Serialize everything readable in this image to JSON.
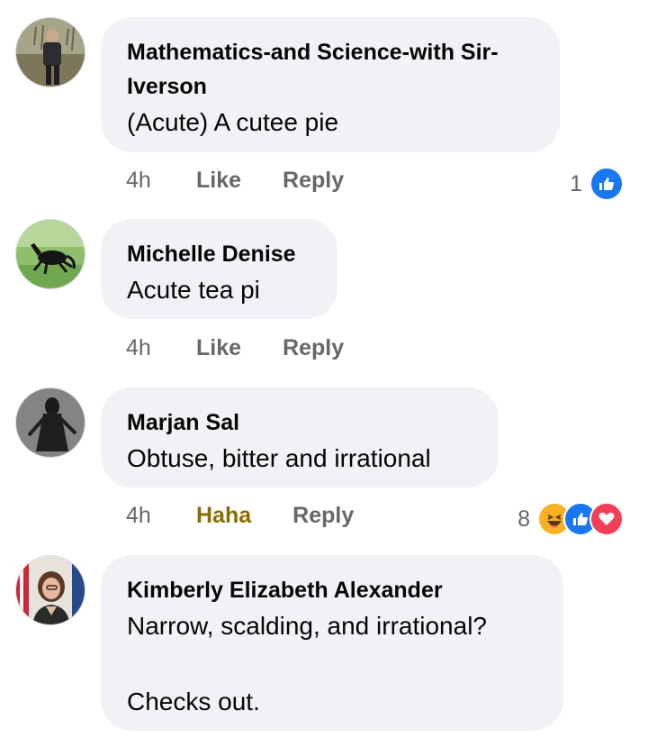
{
  "comments": [
    {
      "author": "Mathematics-and Science-with Sir-\nIverson",
      "text": "(Acute) A cutee pie",
      "time": "4h",
      "action_primary": "Like",
      "action_reply": "Reply",
      "reaction_count": "1",
      "reactions": [
        "like-icon"
      ]
    },
    {
      "author": "Michelle Denise",
      "text": "Acute tea pi",
      "time": "4h",
      "action_primary": "Like",
      "action_reply": "Reply"
    },
    {
      "author": "Marjan Sal",
      "text": "Obtuse, bitter and irrational",
      "time": "4h",
      "action_primary": "Haha",
      "action_reply": "Reply",
      "reaction_count": "8",
      "reactions": [
        "haha-icon",
        "like-icon",
        "love-icon"
      ]
    },
    {
      "author": "Kimberly Elizabeth Alexander",
      "text": "Narrow, scalding, and irrational?\n\nChecks out."
    }
  ],
  "colors": {
    "bubble": "#f0f2f5",
    "meta_text": "#65676b",
    "haha_active": "#8a6d00",
    "like_blue": "#1877f2",
    "love_red": "#f33e58",
    "haha_yellow": "#f7b125"
  }
}
